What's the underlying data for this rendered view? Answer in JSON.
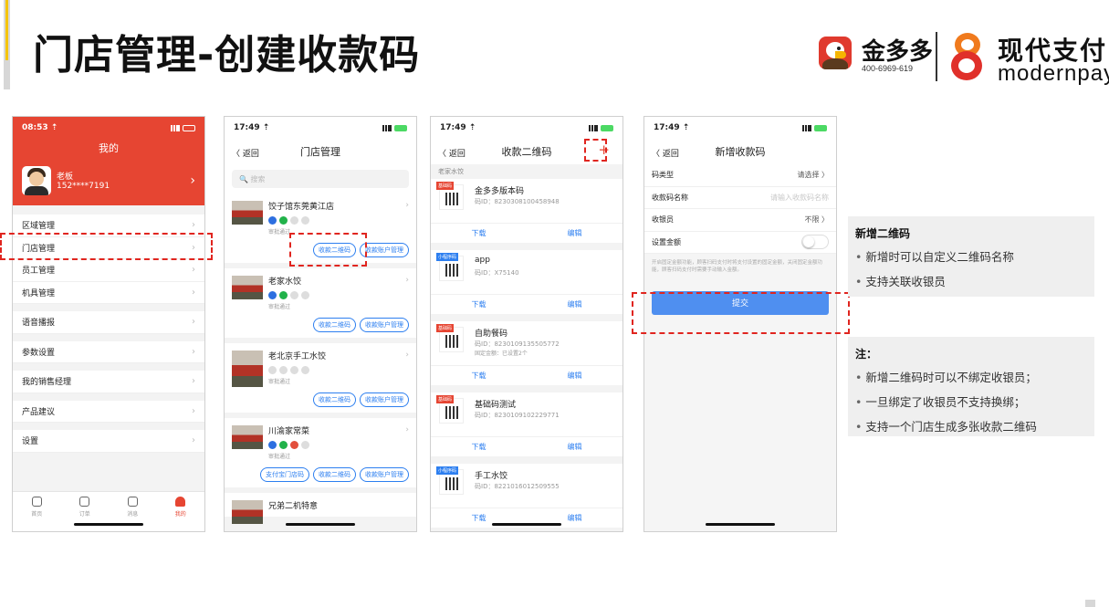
{
  "slide": {
    "title": "门店管理-创建收款码"
  },
  "brand": {
    "jdd_name": "金多多",
    "jdd_tel": "400-6969-619",
    "mp_name": "现代支付",
    "mp_en": "modernpay",
    "brand_red": "#e64532"
  },
  "status": {
    "time1": "08:53 ⇡",
    "time2": "17:49 ⇡"
  },
  "nav": {
    "back": "〈 返回"
  },
  "phone1": {
    "title": "我的",
    "user_name": "老板",
    "user_phone": "152****7191",
    "menu_a": [
      "区域管理",
      "门店管理",
      "员工管理",
      "机具管理"
    ],
    "menu_b": [
      "语音播报"
    ],
    "menu_c": [
      "参数设置"
    ],
    "menu_d": [
      "我的销售经理"
    ],
    "menu_e": [
      "产品建议"
    ],
    "menu_f": [
      "设置"
    ],
    "tabs": [
      "首页",
      "订单",
      "消息",
      "我的"
    ]
  },
  "phone2": {
    "title": "门店管理",
    "search_placeholder": "🔍 搜索",
    "audit": "审批通过",
    "btn_qr": "收款二维码",
    "btn_account": "收款账户管理",
    "btn_alipay": "支付宝门店码",
    "stores": [
      "饺子馆东莞黄江店",
      "老家水饺",
      "老北京手工水饺",
      "川渝家常菜",
      "兄弟二机特意"
    ]
  },
  "phone3": {
    "title": "收款二维码",
    "group": "老家水饺",
    "download": "下载",
    "edit": "编辑",
    "plus": "+",
    "items": [
      {
        "tag": "基础码",
        "name": "金多多版本码",
        "id": "码ID：8230308100458948",
        "amount": ""
      },
      {
        "tag": "小程序码",
        "name": "app",
        "id": "码ID：X75140",
        "amount": ""
      },
      {
        "tag": "基础码",
        "name": "自助餐码",
        "id": "码ID：8230109135505772",
        "amount": "固定金额：已设置2个"
      },
      {
        "tag": "基础码",
        "name": "基础码测试",
        "id": "码ID：8230109102229771",
        "amount": ""
      },
      {
        "tag": "小程序码",
        "name": "手工水饺",
        "id": "码ID：8221016012509555",
        "amount": ""
      }
    ]
  },
  "phone4": {
    "title": "新增收款码",
    "rows": [
      {
        "label": "码类型",
        "value": "请选择 〉",
        "placeholder": false
      },
      {
        "label": "收款码名称",
        "value": "请输入收款码名称",
        "placeholder": true
      },
      {
        "label": "收银员",
        "value": "不限 〉",
        "placeholder": false
      }
    ],
    "amount_label": "设置金额",
    "note": "开启固定金额功能，顾客扫码支付时将支付设置的固定金额，关闭固定金额功能，顾客扫码支付时需要手动输入金额。",
    "submit": "提交"
  },
  "notes": {
    "n1_title": "新增二维码",
    "n1_items": [
      "新增时可以自定义二维码名称",
      "支持关联收银员"
    ],
    "n2_title": "注：",
    "n2_items": [
      "新增二维码时可以不绑定收银员；",
      "一旦绑定了收银员不支持换绑；",
      "支持一个门店生成多张收款二维码"
    ]
  },
  "colors": {
    "accent_yellow": "#f5c400",
    "link_blue": "#2d7ff0",
    "highlight_red": "#e0251f"
  }
}
